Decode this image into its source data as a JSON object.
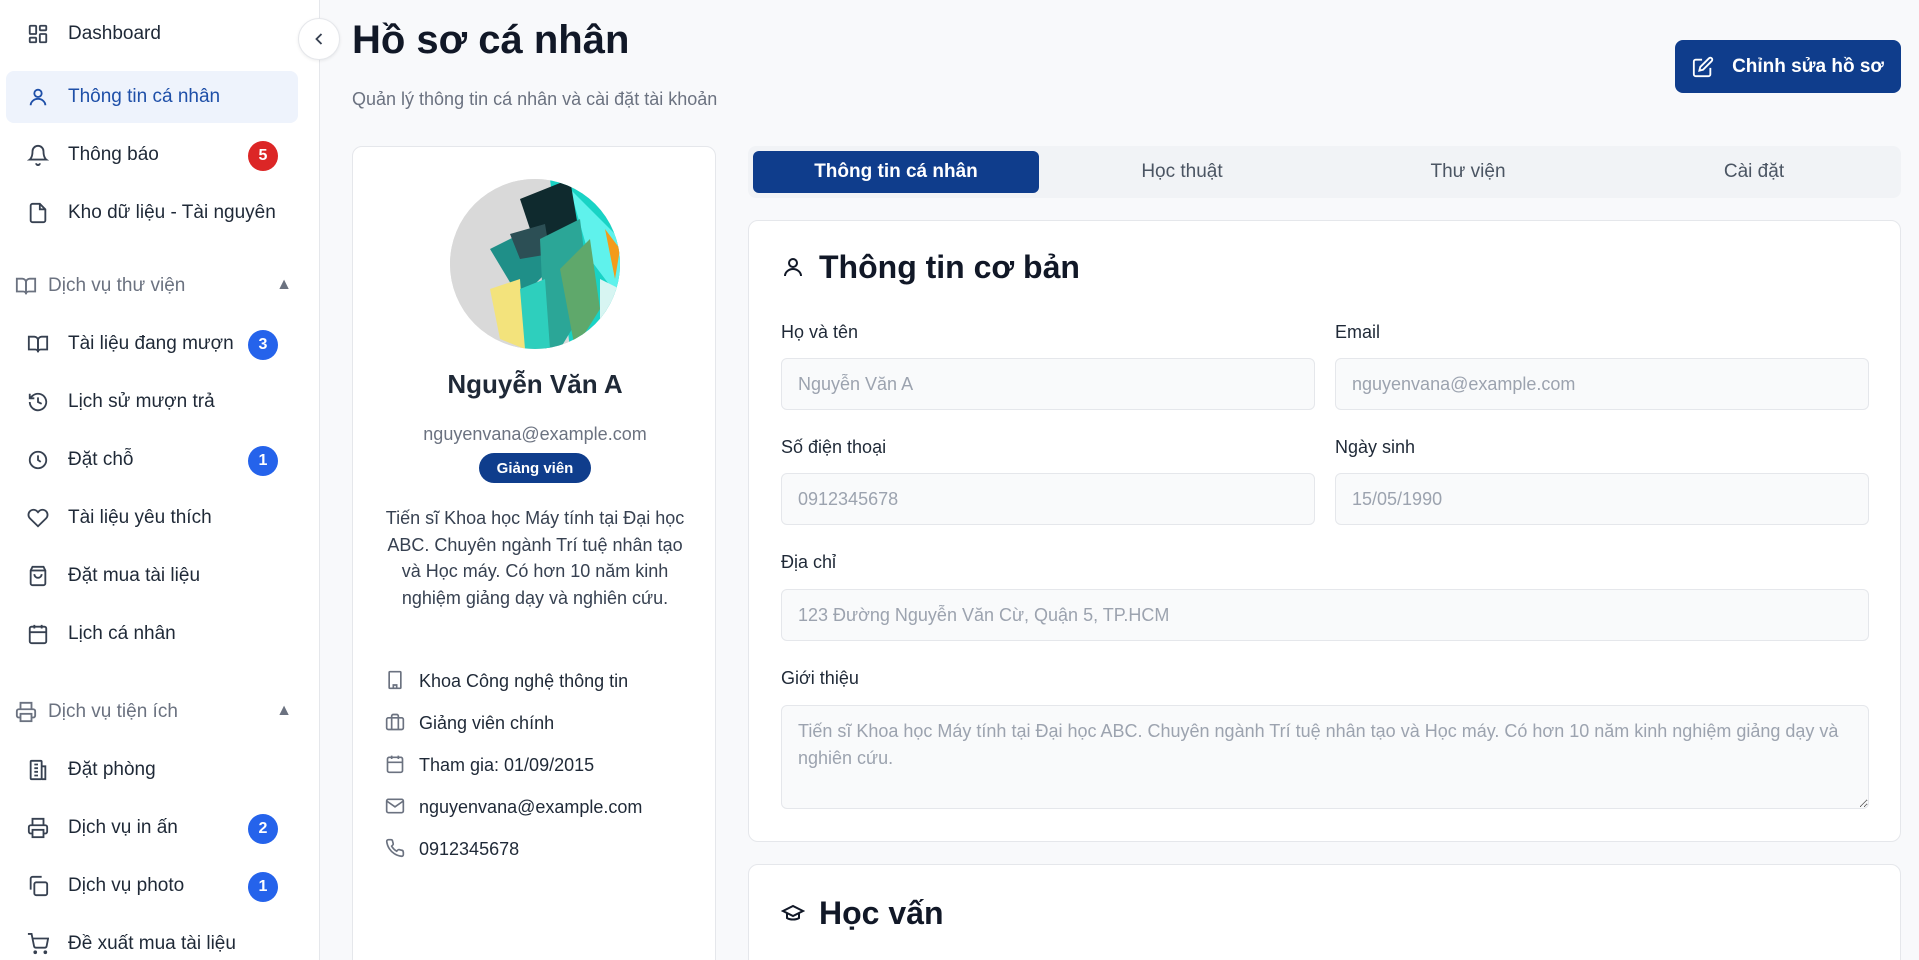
{
  "sidebar": {
    "items": [
      {
        "label": "Dashboard"
      },
      {
        "label": "Thông tin cá nhân"
      },
      {
        "label": "Thông báo",
        "badge": "5"
      },
      {
        "label": "Kho dữ liệu - Tài nguyên"
      }
    ],
    "library_section": {
      "title": "Dịch vụ thư viện",
      "items": [
        {
          "label": "Tài liệu đang mượn",
          "badge": "3"
        },
        {
          "label": "Lịch sử mượn trả"
        },
        {
          "label": "Đặt chỗ",
          "badge": "1"
        },
        {
          "label": "Tài liệu yêu thích"
        },
        {
          "label": "Đặt mua tài liệu"
        },
        {
          "label": "Lịch cá nhân"
        }
      ]
    },
    "utility_section": {
      "title": "Dịch vụ tiện ích",
      "items": [
        {
          "label": "Đặt phòng"
        },
        {
          "label": "Dịch vụ in ấn",
          "badge": "2"
        },
        {
          "label": "Dịch vụ photo",
          "badge": "1"
        },
        {
          "label": "Đề xuất mua tài liệu"
        }
      ]
    }
  },
  "header": {
    "title": "Hồ sơ cá nhân",
    "subtitle": "Quản lý thông tin cá nhân và cài đặt tài khoản",
    "edit_button": "Chỉnh sửa hồ sơ"
  },
  "profile": {
    "name": "Nguyễn Văn A",
    "email": "nguyenvana@example.com",
    "role": "Giảng viên",
    "bio": "Tiến sĩ Khoa học Máy tính tại Đại học ABC. Chuyên ngành Trí tuệ nhân tạo và Học máy. Có hơn 10 năm kinh nghiệm giảng dạy và nghiên cứu.",
    "details": {
      "department": "Khoa Công nghệ thông tin",
      "position": "Giảng viên chính",
      "joined": "Tham gia: 01/09/2015",
      "email": "nguyenvana@example.com",
      "phone": "0912345678"
    }
  },
  "tabs": [
    {
      "label": "Thông tin cá nhân"
    },
    {
      "label": "Học thuật"
    },
    {
      "label": "Thư viện"
    },
    {
      "label": "Cài đặt"
    }
  ],
  "basic_info": {
    "title": "Thông tin cơ bản",
    "fields": {
      "fullname": {
        "label": "Họ và tên",
        "placeholder": "Nguyễn Văn A"
      },
      "email": {
        "label": "Email",
        "placeholder": "nguyenvana@example.com"
      },
      "phone": {
        "label": "Số điện thoại",
        "placeholder": "0912345678"
      },
      "birthday": {
        "label": "Ngày sinh",
        "placeholder": "15/05/1990"
      },
      "address": {
        "label": "Địa chỉ",
        "placeholder": "123 Đường Nguyễn Văn Cừ, Quận 5, TP.HCM"
      },
      "bio": {
        "label": "Giới thiệu",
        "placeholder": "Tiến sĩ Khoa học Máy tính tại Đại học ABC. Chuyên ngành Trí tuệ nhân tạo và Học máy. Có hơn 10 năm kinh nghiệm giảng dạy và nghiên cứu."
      }
    }
  },
  "education": {
    "title": "Học vấn"
  },
  "colors": {
    "primary": "#0f3d8c",
    "active_bg": "#eef3fc",
    "badge_red": "#dc2626",
    "badge_blue": "#2563eb"
  }
}
